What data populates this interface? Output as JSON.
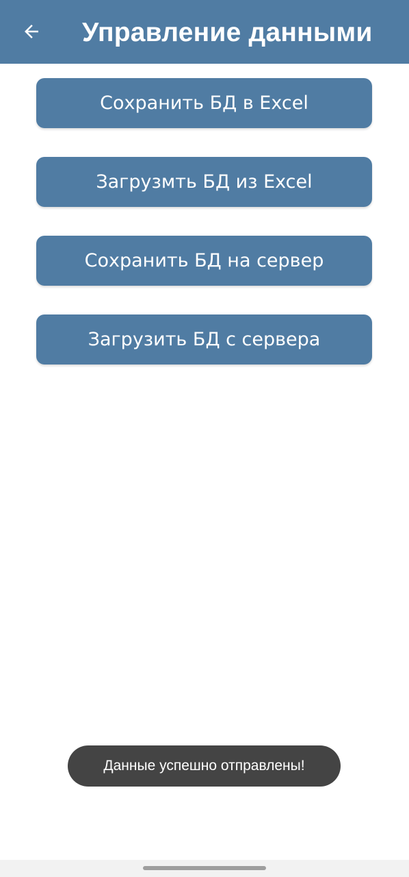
{
  "header": {
    "title": "Управление данными",
    "back_icon": "arrow-left-icon"
  },
  "buttons": [
    {
      "label": "Сохранить БД в Excel"
    },
    {
      "label": "Загрузмть БД из Excel"
    },
    {
      "label": "Сохранить БД на сервер"
    },
    {
      "label": "Загрузить БД с сервера"
    }
  ],
  "toast": {
    "message": "Данные успешно отправлены!"
  },
  "colors": {
    "primary": "#507ca3",
    "toast_bg": "#444444",
    "background": "#ffffff"
  }
}
